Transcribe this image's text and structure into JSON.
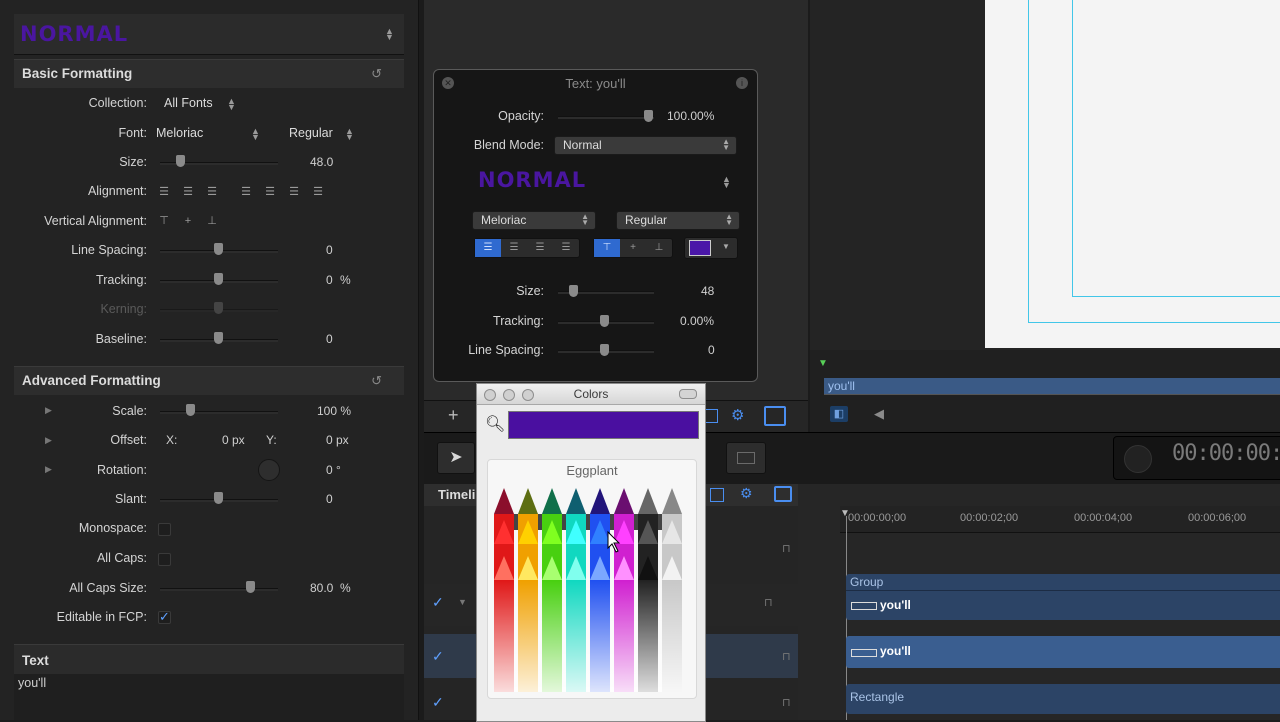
{
  "inspector": {
    "preset_name": "NORMAL",
    "basic": {
      "title": "Basic Formatting",
      "collection_label": "Collection:",
      "collection_value": "All Fonts",
      "font_label": "Font:",
      "font_value": "Meloriac",
      "font_style": "Regular",
      "size_label": "Size:",
      "size_value": "48.0",
      "size_level": 0.1,
      "alignment_label": "Alignment:",
      "valign_label": "Vertical Alignment:",
      "line_spacing_label": "Line Spacing:",
      "line_spacing_value": "0",
      "tracking_label": "Tracking:",
      "tracking_value": "0",
      "tracking_unit": "%",
      "kerning_label": "Kerning:",
      "baseline_label": "Baseline:",
      "baseline_value": "0"
    },
    "advanced": {
      "title": "Advanced Formatting",
      "scale_label": "Scale:",
      "scale_value": "100 %",
      "offset_label": "Offset:",
      "offset_x_label": "X:",
      "offset_x_value": "0 px",
      "offset_y_label": "Y:",
      "offset_y_value": "0 px",
      "rotation_label": "Rotation:",
      "rotation_value": "0 °",
      "slant_label": "Slant:",
      "slant_value": "0",
      "monospace_label": "Monospace:",
      "allcaps_label": "All Caps:",
      "allcaps_size_label": "All Caps Size:",
      "allcaps_size_value": "80.0",
      "allcaps_size_unit": "%",
      "editable_label": "Editable in FCP:",
      "editable_check": "✓"
    },
    "text_section": {
      "title": "Text",
      "content": "you'll"
    }
  },
  "hud": {
    "title": "Text: you'll",
    "opacity_label": "Opacity:",
    "opacity_value": "100.00%",
    "blend_label": "Blend Mode:",
    "blend_value": "Normal",
    "preset_name": "NORMAL",
    "font_value": "Meloriac",
    "style_value": "Regular",
    "size_label": "Size:",
    "size_value": "48",
    "tracking_label": "Tracking:",
    "tracking_value": "0.00%",
    "line_spacing_label": "Line Spacing:",
    "line_spacing_value": "0",
    "swatch_color": "#4a17a8"
  },
  "colors_window": {
    "title": "Colors",
    "selected_color": "#4a0fa0",
    "color_name": "Eggplant"
  },
  "viewer": {
    "timecode": "00:00:00:0",
    "clip_label": "you'll"
  },
  "timeline": {
    "title": "Timeli",
    "ruler": [
      "00:00:00;00",
      "00:00:02;00",
      "00:00:04;00",
      "00:00:06;00"
    ],
    "group_label": "Group",
    "clip1": "you'll",
    "clip2": "you'll",
    "clip3": "Rectangle",
    "check": "✓"
  }
}
